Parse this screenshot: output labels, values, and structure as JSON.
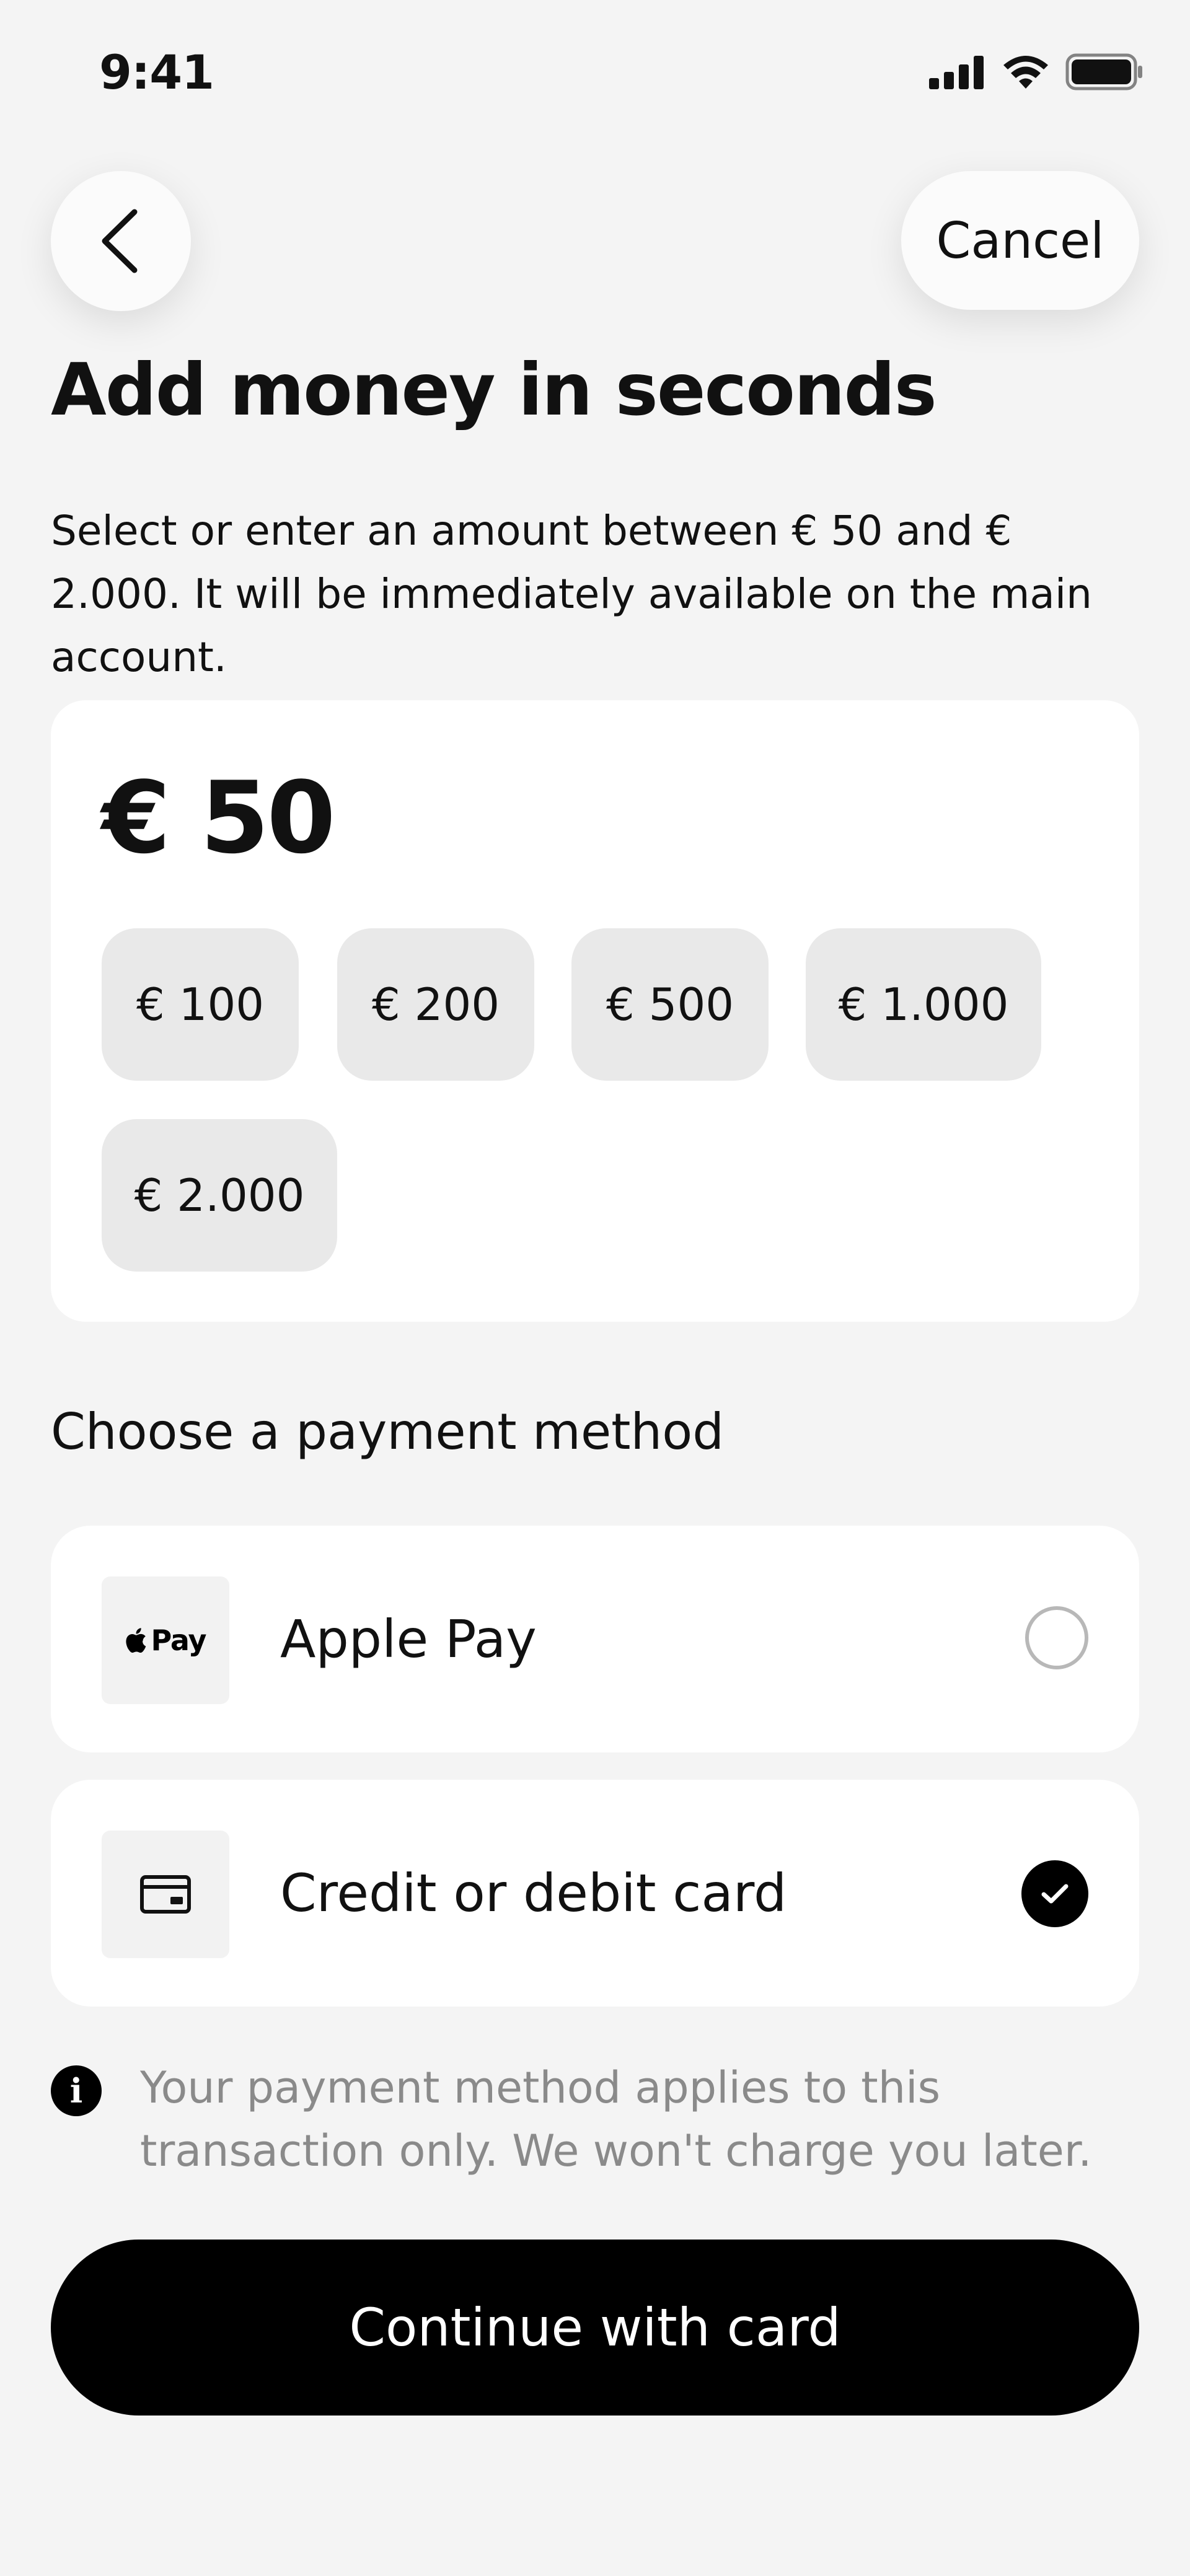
{
  "status_bar": {
    "time": "9:41"
  },
  "nav": {
    "back_icon": "chevron-left-icon",
    "cancel_label": "Cancel"
  },
  "header": {
    "title": "Add money in seconds",
    "subtitle": "Select or enter an amount between € 50 and € 2.000. It will be immediately available on the main account."
  },
  "amount": {
    "value": "€ 50",
    "presets": [
      "€ 100",
      "€ 200",
      "€ 500",
      "€ 1.000",
      "€ 2.000"
    ]
  },
  "payment": {
    "section_title": "Choose a payment method",
    "options": [
      {
        "label": "Apple Pay",
        "icon": "apple-pay-icon",
        "badge_text": "Pay",
        "selected": false
      },
      {
        "label": "Credit or debit card",
        "icon": "credit-card-icon",
        "selected": true
      }
    ]
  },
  "info": {
    "icon": "info-icon",
    "text": "Your payment method applies to this transaction only. We won't charge you later."
  },
  "cta": {
    "label": "Continue with card"
  },
  "colors": {
    "background": "#f4f4f4",
    "card": "#ffffff",
    "chip": "#e9e9e9",
    "primary": "#000000",
    "muted_text": "#8a8a8a"
  }
}
